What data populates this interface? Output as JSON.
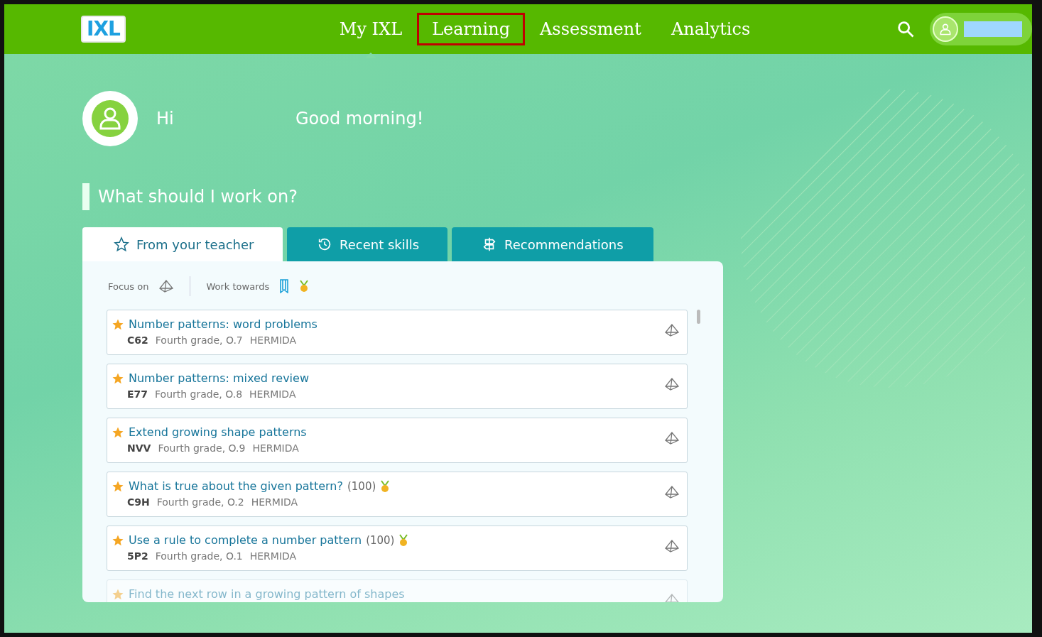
{
  "header": {
    "logo": "IXL",
    "nav": [
      {
        "label": "My IXL",
        "selected": true,
        "highlighted": false
      },
      {
        "label": "Learning",
        "selected": false,
        "highlighted": true
      },
      {
        "label": "Assessment",
        "selected": false,
        "highlighted": false
      },
      {
        "label": "Analytics",
        "selected": false,
        "highlighted": false
      }
    ]
  },
  "greeting": {
    "hi": "Hi",
    "message": "Good morning!"
  },
  "section_title": "What should I work on?",
  "tabs": [
    {
      "label": "From your teacher",
      "selected": true,
      "kind": "star"
    },
    {
      "label": "Recent skills",
      "selected": false,
      "kind": "history"
    },
    {
      "label": "Recommendations",
      "selected": false,
      "kind": "signpost"
    }
  ],
  "filters": {
    "focus_label": "Focus on",
    "work_label": "Work towards"
  },
  "skills": [
    {
      "title": "Number patterns: word problems",
      "medal": false,
      "code": "C62",
      "grade": "Fourth grade, O.7",
      "teacher": "HERMIDA",
      "faded": false
    },
    {
      "title": "Number patterns: mixed review",
      "medal": false,
      "code": "E77",
      "grade": "Fourth grade, O.8",
      "teacher": "HERMIDA",
      "faded": false
    },
    {
      "title": "Extend growing shape patterns",
      "medal": false,
      "code": "NVV",
      "grade": "Fourth grade, O.9",
      "teacher": "HERMIDA",
      "faded": false
    },
    {
      "title": "What is true about the given pattern?",
      "score": "(100)",
      "medal": true,
      "code": "C9H",
      "grade": "Fourth grade, O.2",
      "teacher": "HERMIDA",
      "faded": false
    },
    {
      "title": "Use a rule to complete a number pattern",
      "score": "(100)",
      "medal": true,
      "code": "5P2",
      "grade": "Fourth grade, O.1",
      "teacher": "HERMIDA",
      "faded": false
    },
    {
      "title": "Find the next row in a growing pattern of shapes",
      "medal": false,
      "faded": true
    }
  ]
}
